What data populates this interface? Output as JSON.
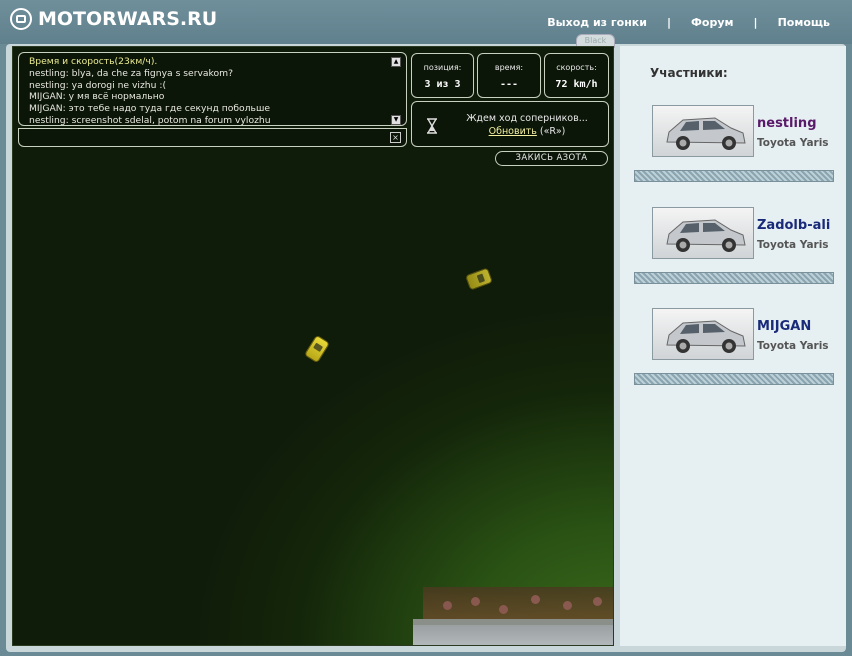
{
  "header": {
    "logo_text": "MOTORWARS.RU",
    "nav": [
      {
        "label": "Выход из гонки"
      },
      {
        "label": "Форум"
      },
      {
        "label": "Помощь"
      }
    ],
    "separator": "|",
    "tab_label": "Black"
  },
  "chat": {
    "lines": [
      {
        "text": "Время и скорость(23км/ч).",
        "system": true
      },
      {
        "text": "nestling: blya, da che za fignya s servakom?"
      },
      {
        "text": "nestling: ya dorogi ne vizhu :("
      },
      {
        "text": "MIJGAN: у мя всё нормально"
      },
      {
        "text": "MIJGAN: это тебе надо туда где секунд побольше"
      },
      {
        "text": "nestling: screenshot sdelal, potom na forum vylozhu"
      }
    ],
    "input_value": "",
    "close_symbol": "×"
  },
  "stats": {
    "position_label": "позиция:",
    "position_value": "3 из 3",
    "time_label": "время:",
    "time_value": "---",
    "speed_label": "скорость:",
    "speed_value": "72 km/h"
  },
  "wait": {
    "text": "Ждем ход соперников...",
    "refresh_label": "Обновить",
    "hotkey": "(«R»)"
  },
  "nitro_label": "ЗАКИСЬ АЗОТА",
  "participants": {
    "title": "Участники:",
    "list": [
      {
        "name": "nestling",
        "car": "Toyota Yaris"
      },
      {
        "name": "Zadolb-ali",
        "car": "Toyota Yaris"
      },
      {
        "name": "MIJGAN",
        "car": "Toyota Yaris"
      }
    ]
  },
  "colors": {
    "header_bg": "#6a8a96",
    "game_bg": "#101c0a",
    "grass": "#2a5214",
    "car": "#e8d838",
    "participant_name": "#1a2a7a",
    "participant_self": "#5a1a6a"
  }
}
